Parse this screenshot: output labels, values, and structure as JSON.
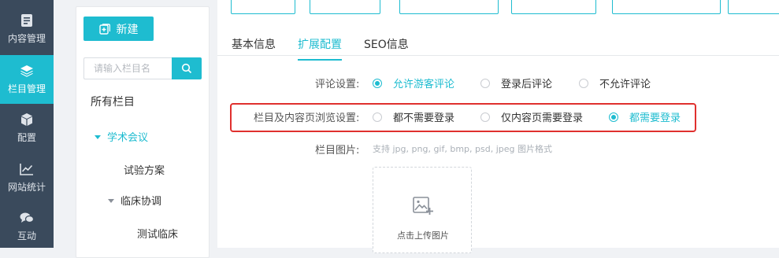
{
  "nav": {
    "items": [
      {
        "label": "内容管理",
        "icon": "document-icon"
      },
      {
        "label": "栏目管理",
        "icon": "layers-icon",
        "active": true
      },
      {
        "label": "配置",
        "icon": "cube-icon"
      },
      {
        "label": "网站统计",
        "icon": "line-chart-icon"
      },
      {
        "label": "互动",
        "icon": "chat-icon"
      }
    ]
  },
  "tree": {
    "new_button": "新建",
    "search_placeholder": "请输入栏目名",
    "root": "所有栏目",
    "items": [
      {
        "label": "学术会议",
        "selected": true
      },
      {
        "label": "试验方案"
      },
      {
        "label": "临床协调"
      },
      {
        "label": "测试临床"
      }
    ]
  },
  "tabs": [
    "基本信息",
    "扩展配置",
    "SEO信息"
  ],
  "form": {
    "comment": {
      "label": "评论设置:",
      "options": [
        "允许游客评论",
        "登录后评论",
        "不允许评论"
      ],
      "selected": "允许游客评论"
    },
    "browse": {
      "label": "栏目及内容页浏览设置:",
      "options": [
        "都不需要登录",
        "仅内容页需要登录",
        "都需要登录"
      ],
      "selected": "都需要登录"
    },
    "image": {
      "label": "栏目图片:",
      "hint": "支持 jpg, png, gif, bmp, psd, jpeg 图片格式",
      "upload_text": "点击上传图片"
    }
  },
  "colors": {
    "accent": "#1ebcd0",
    "nav_bg": "#3a4a5c",
    "highlight": "#e0302e"
  }
}
